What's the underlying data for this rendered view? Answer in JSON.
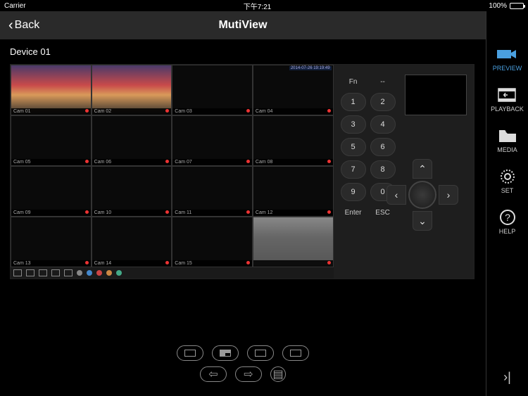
{
  "status_bar": {
    "carrier": "Carrier",
    "wifi": "☰",
    "time": "下午7:21",
    "battery_pct": "100%"
  },
  "header": {
    "back_label": "Back",
    "title": "MutiView"
  },
  "device_label": "Device 01",
  "camera_grid": {
    "timestamp": "2014-07-26 19:19:49",
    "cells": [
      {
        "label": "Cam 01",
        "live": true
      },
      {
        "label": "Cam 02",
        "live": true
      },
      {
        "label": "Cam 03",
        "live": false
      },
      {
        "label": "Cam 04",
        "live": false,
        "has_ts": true
      },
      {
        "label": "Cam 05",
        "live": false
      },
      {
        "label": "Cam 06",
        "live": false
      },
      {
        "label": "Cam 07",
        "live": false
      },
      {
        "label": "Cam 08",
        "live": false
      },
      {
        "label": "Cam 09",
        "live": false
      },
      {
        "label": "Cam 10",
        "live": false
      },
      {
        "label": "Cam 11",
        "live": false
      },
      {
        "label": "Cam 12",
        "live": false
      },
      {
        "label": "Cam 13",
        "live": false
      },
      {
        "label": "Cam 14",
        "live": false
      },
      {
        "label": "Cam 15",
        "live": false
      },
      {
        "label": "",
        "live": false,
        "gray": true
      }
    ]
  },
  "remote": {
    "keys_row1": [
      "Fn",
      "--"
    ],
    "keys_nums": [
      "1",
      "2",
      "3",
      "4",
      "5",
      "6",
      "7",
      "8",
      "9",
      "0"
    ],
    "enter": "Enter",
    "esc": "ESC"
  },
  "sidebar": {
    "items": [
      {
        "label": "PREVIEW",
        "icon": "camera",
        "active": true
      },
      {
        "label": "PLAYBACK",
        "icon": "film",
        "active": false
      },
      {
        "label": "MEDIA",
        "icon": "folder",
        "active": false
      },
      {
        "label": "SET",
        "icon": "gear",
        "active": false
      },
      {
        "label": "HELP",
        "icon": "help",
        "active": false
      }
    ]
  },
  "layout_buttons": [
    "1-view",
    "4-view",
    "9-view",
    "16-view"
  ],
  "nav_buttons": [
    "prev",
    "next",
    "list"
  ]
}
